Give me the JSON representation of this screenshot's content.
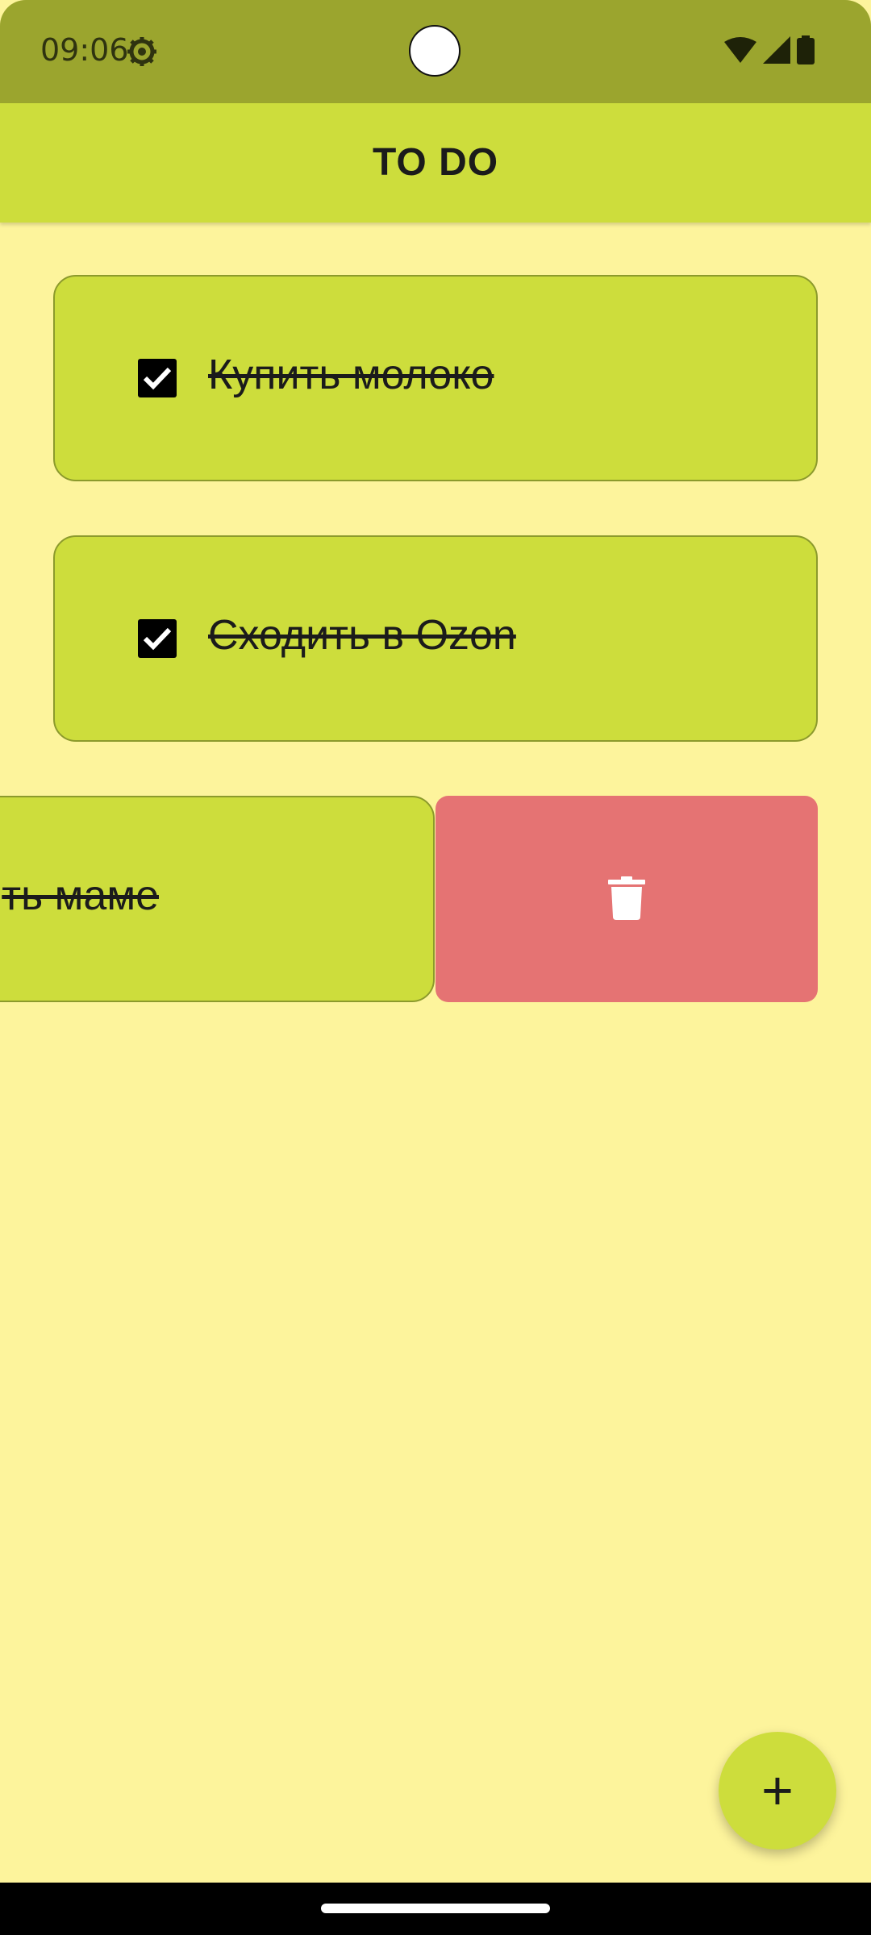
{
  "status_bar": {
    "time": "09:06",
    "icons": [
      "gear-icon",
      "wifi-icon",
      "cellular-signal-icon",
      "battery-icon"
    ]
  },
  "app_bar": {
    "title": "TO DO"
  },
  "tasks": [
    {
      "text": "Купить молоко",
      "checked": true
    },
    {
      "text": "Сходить в Ozon",
      "checked": true
    },
    {
      "text": "ть маме",
      "checked": true,
      "swiped": true
    }
  ],
  "delete_action": {
    "icon": "trash-icon",
    "color": "#E57373"
  },
  "fab": {
    "label": "+",
    "icon": "plus-icon"
  },
  "colors": {
    "background": "#FDF49C",
    "status_bar": "#9BA52E",
    "app_bar": "#CDDD3C",
    "card": "#CDDD3C",
    "delete": "#E57373"
  }
}
